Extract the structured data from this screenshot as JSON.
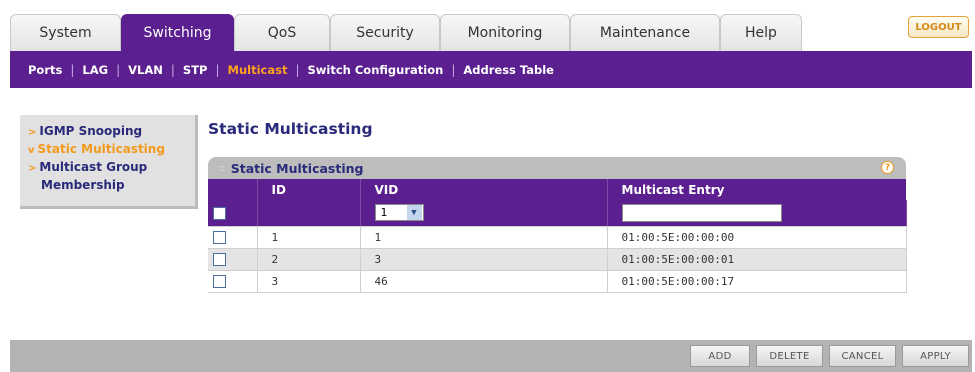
{
  "tabs": [
    {
      "label": "System",
      "active": false
    },
    {
      "label": "Switching",
      "active": true
    },
    {
      "label": "QoS",
      "active": false
    },
    {
      "label": "Security",
      "active": false
    },
    {
      "label": "Monitoring",
      "active": false
    },
    {
      "label": "Maintenance",
      "active": false
    },
    {
      "label": "Help",
      "active": false
    }
  ],
  "logout_label": "LOGOUT",
  "subnav": [
    {
      "label": "Ports",
      "active": false
    },
    {
      "label": "LAG",
      "active": false
    },
    {
      "label": "VLAN",
      "active": false
    },
    {
      "label": "STP",
      "active": false
    },
    {
      "label": "Multicast",
      "active": true
    },
    {
      "label": "Switch Configuration",
      "active": false
    },
    {
      "label": "Address Table",
      "active": false
    }
  ],
  "leftmenu": {
    "items": [
      {
        "label": "IGMP Snooping",
        "arrow": ">",
        "active": false
      },
      {
        "label": "Static Multicasting",
        "arrow": "v",
        "active": true
      },
      {
        "label": "Multicast Group",
        "arrow": ">",
        "active": false
      },
      {
        "label": "Membership",
        "arrow": "",
        "active": false
      }
    ]
  },
  "page_title": "Static Multicasting",
  "panel": {
    "title": "Static Multicasting",
    "help": "?",
    "columns": [
      "ID",
      "VID",
      "Multicast Entry"
    ],
    "edit_row": {
      "vid_selected": "1",
      "multicast_entry": ""
    },
    "rows": [
      {
        "id": "1",
        "vid": "1",
        "entry": "01:00:5E:00:00:00"
      },
      {
        "id": "2",
        "vid": "3",
        "entry": "01:00:5E:00:00:01"
      },
      {
        "id": "3",
        "vid": "46",
        "entry": "01:00:5E:00:00:17"
      }
    ]
  },
  "footer": {
    "add": "ADD",
    "delete": "DELETE",
    "cancel": "CANCEL",
    "apply": "APPLY"
  },
  "colors": {
    "accent_purple": "#5b1f8f",
    "highlight_orange": "#f39a1c",
    "title_blue": "#2a2a7a"
  }
}
